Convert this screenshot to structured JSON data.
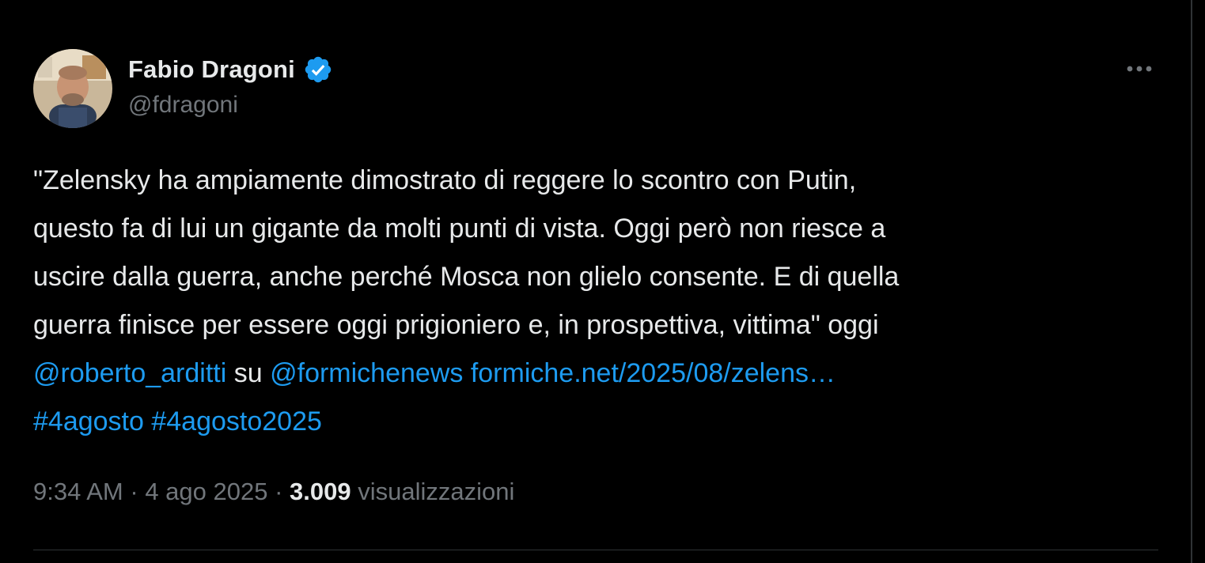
{
  "author": {
    "display_name": "Fabio Dragoni",
    "handle": "@fdragoni",
    "verified": true,
    "verified_color": "#1d9bf0",
    "avatar": "profile-photo"
  },
  "menu": {
    "more_icon": "more-horizontal-icon"
  },
  "tweet": {
    "line1": "\"Zelensky ha ampiamente dimostrato di reggere lo scontro con Putin,",
    "line2": "questo fa di lui un gigante da molti punti di vista. Oggi però non riesce a",
    "line3": "uscire dalla guerra, anche perché Mosca non glielo consente. E di quella",
    "line4": "guerra finisce per essere oggi prigioniero e, in prospettiva, vittima\" oggi",
    "mention1": "@roberto_arditti",
    "connector": " su ",
    "mention2": "@formichenews",
    "url": "formiche.net/2025/08/zelens…",
    "hashtag1": "#4agosto",
    "hashtag2": "#4agosto2025"
  },
  "meta": {
    "time": "9:34 AM",
    "separator": " · ",
    "date": "4 ago 2025",
    "views_count": "3.009",
    "views_label": "visualizzazioni"
  },
  "colors": {
    "background": "#000000",
    "text": "#e7e9ea",
    "secondary": "#71767b",
    "link": "#1d9bf0",
    "border": "#2f3336"
  }
}
